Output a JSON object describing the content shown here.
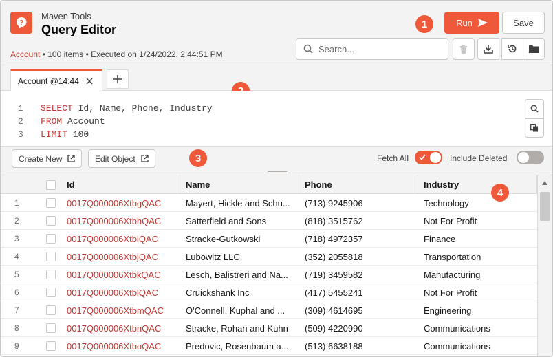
{
  "header": {
    "app_subtitle": "Maven Tools",
    "app_title": "Query Editor",
    "meta_object": "Account",
    "meta_rest": " • 100 items • Executed on 1/24/2022, 2:44:51 PM",
    "run_label": "Run",
    "save_label": "Save",
    "search_placeholder": "Search..."
  },
  "callouts": [
    "1",
    "2",
    "3",
    "4"
  ],
  "tabs": [
    {
      "label": "Account @14:44"
    }
  ],
  "editor": {
    "lines": [
      {
        "num": "1",
        "kw": "SELECT",
        "rest": " Id, Name, Phone, Industry"
      },
      {
        "num": "2",
        "kw": "FROM",
        "rest": " Account"
      },
      {
        "num": "3",
        "kw": "LIMIT",
        "rest": " 100"
      }
    ]
  },
  "toolbar": {
    "create_new_label": "Create New",
    "edit_object_label": "Edit Object",
    "fetch_all_label": "Fetch All",
    "fetch_all_on": true,
    "include_deleted_label": "Include Deleted",
    "include_deleted_on": false
  },
  "grid": {
    "columns": [
      "Id",
      "Name",
      "Phone",
      "Industry"
    ],
    "rows": [
      {
        "n": "1",
        "id": "0017Q000006XtbgQAC",
        "name": "Mayert, Hickle and Schu...",
        "phone": "(713) 9245906",
        "industry": "Technology"
      },
      {
        "n": "2",
        "id": "0017Q000006XtbhQAC",
        "name": "Satterfield and Sons",
        "phone": "(818) 3515762",
        "industry": "Not For Profit"
      },
      {
        "n": "3",
        "id": "0017Q000006XtbiQAC",
        "name": "Stracke-Gutkowski",
        "phone": "(718) 4972357",
        "industry": "Finance"
      },
      {
        "n": "4",
        "id": "0017Q000006XtbjQAC",
        "name": "Lubowitz LLC",
        "phone": "(352) 2055818",
        "industry": "Transportation"
      },
      {
        "n": "5",
        "id": "0017Q000006XtbkQAC",
        "name": "Lesch, Balistreri and Na...",
        "phone": "(719) 3459582",
        "industry": "Manufacturing"
      },
      {
        "n": "6",
        "id": "0017Q000006XtblQAC",
        "name": "Cruickshank Inc",
        "phone": "(417) 5455241",
        "industry": "Not For Profit"
      },
      {
        "n": "7",
        "id": "0017Q000006XtbmQAC",
        "name": "O'Connell, Kuphal and ...",
        "phone": "(309) 4614695",
        "industry": "Engineering"
      },
      {
        "n": "8",
        "id": "0017Q000006XtbnQAC",
        "name": "Stracke, Rohan and Kuhn",
        "phone": "(509) 4220990",
        "industry": "Communications"
      },
      {
        "n": "9",
        "id": "0017Q000006XtboQAC",
        "name": "Predovic, Rosenbaum a...",
        "phone": "(513) 6638188",
        "industry": "Communications"
      }
    ]
  },
  "colors": {
    "accent": "#f0583a",
    "link": "#c23934"
  }
}
